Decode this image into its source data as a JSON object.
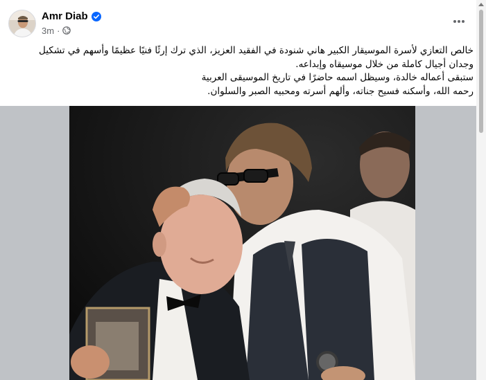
{
  "post": {
    "author": "Amr Diab",
    "time": "3m",
    "privacy_icon": "globe-icon",
    "verified_icon": "verified-badge-icon",
    "more_icon": "more-options-icon",
    "text_lines": [
      "خالص التعازي لأسرة الموسيقار الكبير هاني شنودة في الفقيد العزيز، الذي ترك إرثًا فنيًا عظيمًا وأسهم في تشكيل",
      "وجدان أجيال كاملة من خلال موسيقاه وإبداعه.",
      "ستبقى أعماله خالدة، وسيظل اسمه حاضرًا في تاريخ الموسيقى العربية",
      "رحمه الله، وأسكنه فسيح جناته، وألهم أسرته ومحبيه الصبر والسلوان."
    ]
  },
  "colors": {
    "verified_blue": "#0866ff",
    "secondary_text": "#65676b",
    "media_background": "#bfc2c6"
  }
}
